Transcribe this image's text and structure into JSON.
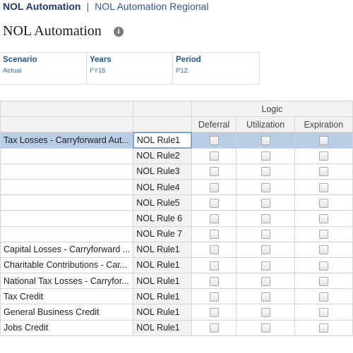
{
  "nav": {
    "active_tab": "NOL Automation",
    "separator": "|",
    "other_tab": "NOL Automation Regional"
  },
  "page": {
    "title": "NOL Automation",
    "info_icon": "i"
  },
  "pov": [
    {
      "label": "Scenario",
      "value": "Actual"
    },
    {
      "label": "Years",
      "value": "FY15"
    },
    {
      "label": "Period",
      "value": "P12"
    }
  ],
  "grid": {
    "group_header": "Logic",
    "columns": [
      "Deferral",
      "Utilization",
      "Expiration"
    ],
    "rows": [
      {
        "label": "Tax Losses - Carryforward Aut...",
        "rule": "NOL Rule1"
      },
      {
        "label": "",
        "rule": "NOL Rule2"
      },
      {
        "label": "",
        "rule": "NOL Rule3"
      },
      {
        "label": "",
        "rule": "NOL Rule4"
      },
      {
        "label": "",
        "rule": "NOL Rule5"
      },
      {
        "label": "",
        "rule": "NOL Rule 6"
      },
      {
        "label": "",
        "rule": "NOL Rule 7"
      },
      {
        "label": "Capital Losses - Carryforward ...",
        "rule": "NOL Rule1"
      },
      {
        "label": "Charitable Contributions - Car...",
        "rule": "NOL Rule1"
      },
      {
        "label": "National Tax Losses - Carryfor...",
        "rule": "NOL Rule1"
      },
      {
        "label": "Tax Credit",
        "rule": "NOL Rule1"
      },
      {
        "label": "General Business Credit",
        "rule": "NOL Rule1"
      },
      {
        "label": "Jobs Credit",
        "rule": "NOL Rule1"
      }
    ]
  }
}
